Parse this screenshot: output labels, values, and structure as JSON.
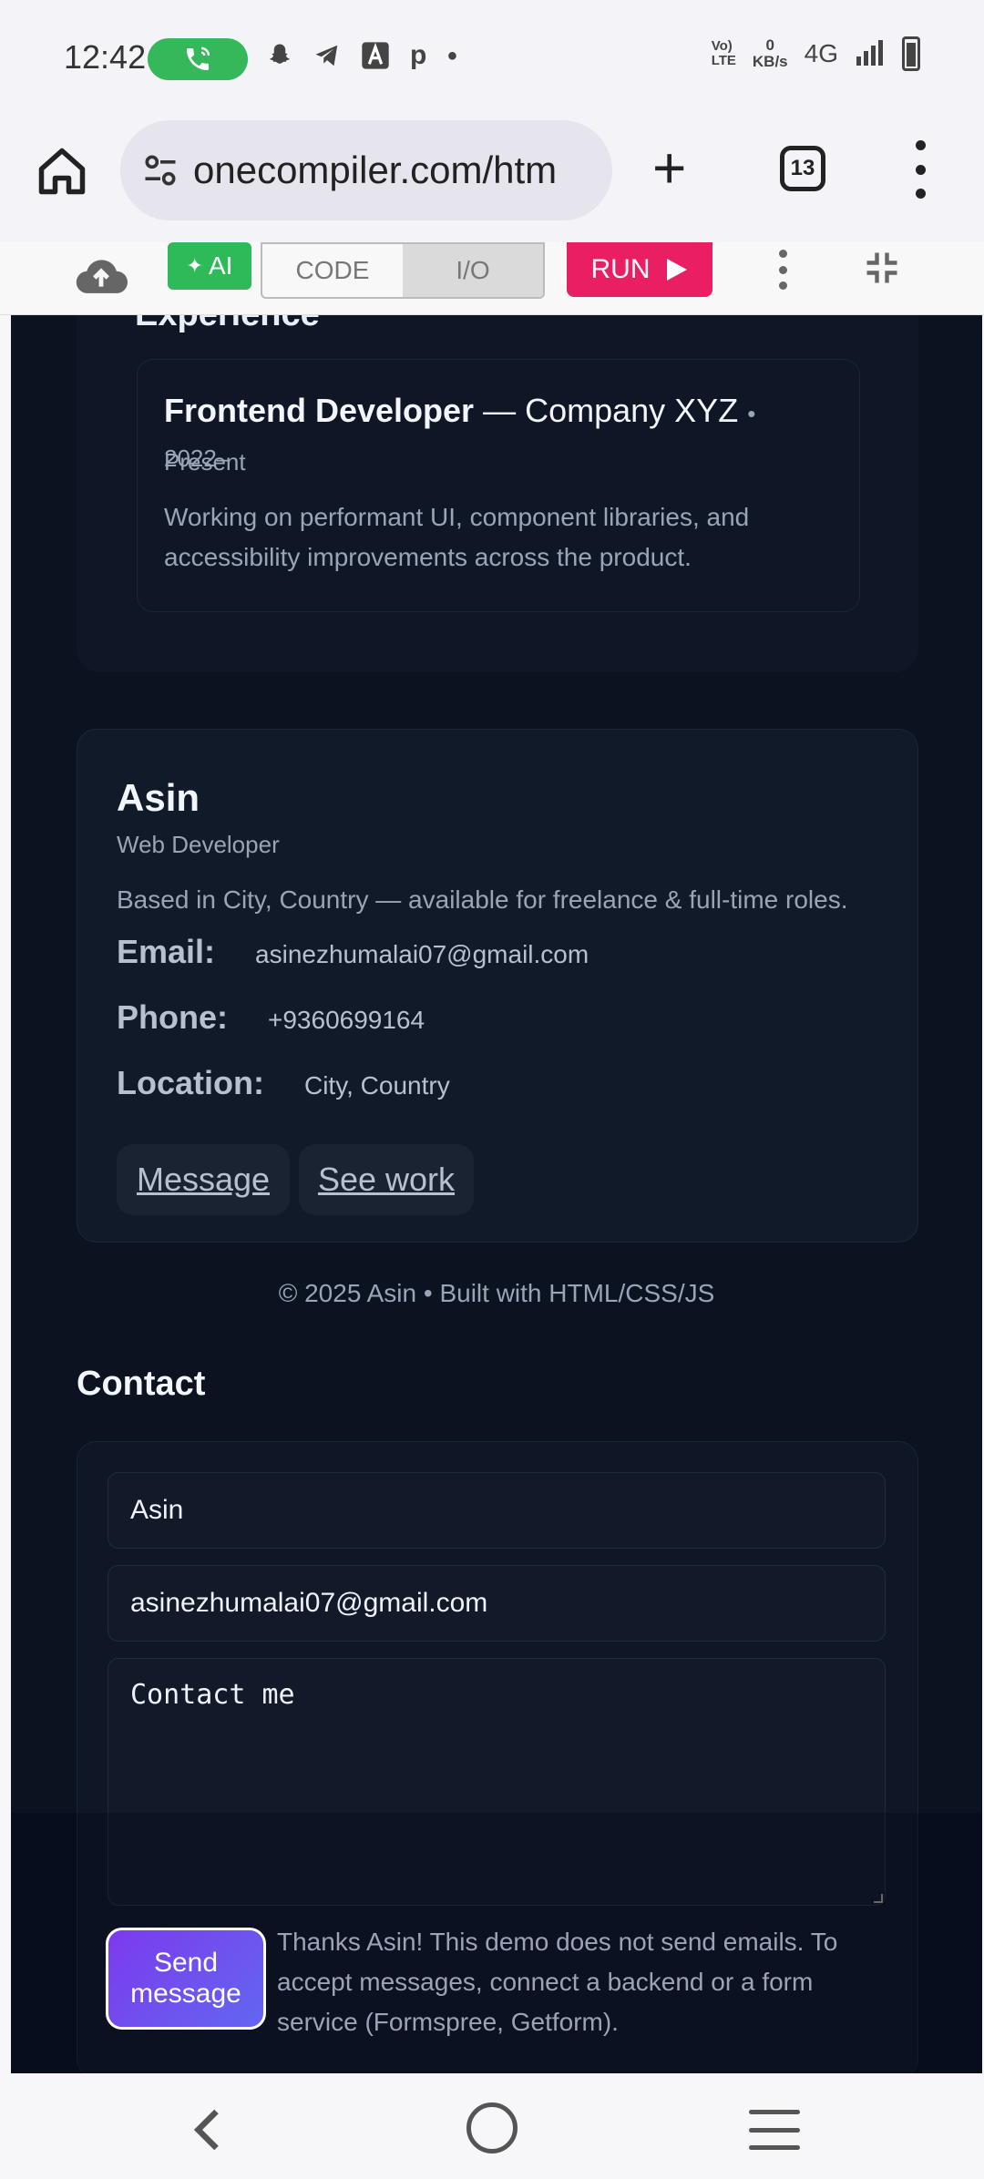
{
  "status_bar": {
    "time": "12:42",
    "volte": "Vo) LTE",
    "net_speed_value": "0",
    "net_speed_unit": "KB/s",
    "network": "4G",
    "icons": [
      "phone-call-icon",
      "snapchat-icon",
      "telegram-icon",
      "a-app-icon",
      "p-app-icon",
      "dot-icon",
      "signal-icon",
      "battery-icon"
    ],
    "call_color": "#34b85a"
  },
  "browser": {
    "url": "onecompiler.com/htm",
    "tab_count": "13"
  },
  "toolbar": {
    "ai_label": "AI",
    "code_label": "CODE",
    "io_label": "I/O",
    "run_label": "RUN",
    "run_color": "#e91e63"
  },
  "page": {
    "experience_heading": "Experience",
    "job": {
      "title": "Frontend Developer",
      "separator": "—",
      "company": "Company XYZ",
      "date_start": "• 2022–",
      "date_end": "Present",
      "description": "Working on performant UI, component libraries, and accessibility improvements across the product."
    },
    "profile": {
      "name": "Asin",
      "role": "Web Developer",
      "bio": "Based in City, Country — available for freelance & full-time roles.",
      "email_label": "Email:",
      "email": "asinezhumalai07@gmail.com",
      "phone_label": "Phone:",
      "phone": "+9360699164",
      "location_label": "Location:",
      "location": "City, Country",
      "message_button": "Message",
      "see_work_button": "See work"
    },
    "footer": "© 2025 Asin • Built with HTML/CSS/JS",
    "contact": {
      "heading": "Contact",
      "name_value": "Asin",
      "email_value": "asinezhumalai07@gmail.com",
      "message_value": "Contact me",
      "send_button": "Send message",
      "note": "Thanks Asin! This demo does not send emails. To accept messages, connect a backend or a form service (Formspree, Getform)."
    }
  }
}
